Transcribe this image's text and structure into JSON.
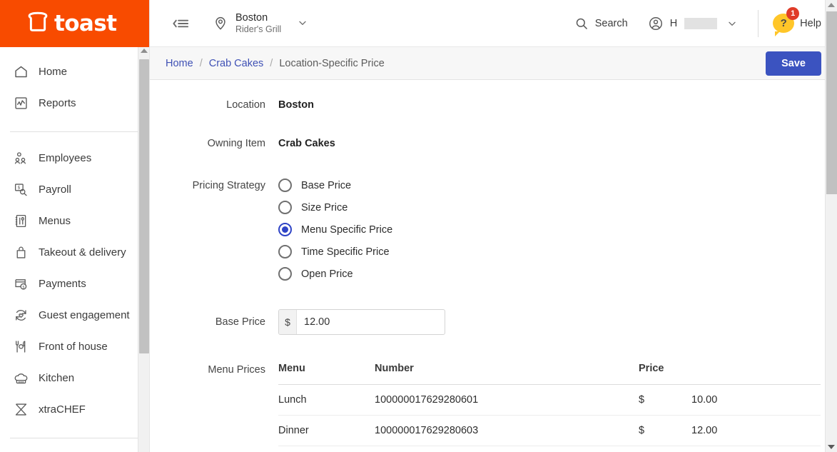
{
  "brand": {
    "name": "toast",
    "logo_icon": "toast-bread-icon",
    "color": "#f84b00"
  },
  "sidebar": {
    "groups": [
      {
        "items": [
          {
            "label": "Home",
            "icon": "home-icon"
          },
          {
            "label": "Reports",
            "icon": "reports-chart-icon"
          }
        ]
      },
      {
        "items": [
          {
            "label": "Employees",
            "icon": "employees-icon"
          },
          {
            "label": "Payroll",
            "icon": "payroll-icon"
          },
          {
            "label": "Menus",
            "icon": "menus-icon"
          },
          {
            "label": "Takeout & delivery",
            "icon": "takeout-bag-icon"
          },
          {
            "label": "Payments",
            "icon": "payments-icon"
          },
          {
            "label": "Guest engagement",
            "icon": "guest-engagement-icon"
          },
          {
            "label": "Front of house",
            "icon": "front-of-house-icon"
          },
          {
            "label": "Kitchen",
            "icon": "kitchen-chef-hat-icon"
          },
          {
            "label": "xtraCHEF",
            "icon": "xtrachef-icon"
          }
        ]
      }
    ]
  },
  "topbar": {
    "collapse_icon": "collapse-sidebar-icon",
    "location": {
      "pin_icon": "location-pin-icon",
      "name": "Boston",
      "restaurant": "Rider's Grill",
      "caret_icon": "chevron-down-icon"
    },
    "search": {
      "label": "Search",
      "icon": "search-icon"
    },
    "account": {
      "icon": "user-avatar-icon",
      "name": "H",
      "caret_icon": "chevron-down-icon"
    },
    "help": {
      "label": "Help",
      "icon": "help-question-bubble-icon",
      "badge": "1",
      "badge_color": "#e03b28",
      "bubble_color": "#ffc629"
    }
  },
  "breadcrumb": {
    "items": [
      "Home",
      "Crab Cakes",
      "Location-Specific Price"
    ],
    "separator": "/"
  },
  "actions": {
    "save_label": "Save",
    "save_color": "#3b53c0"
  },
  "form": {
    "location": {
      "label": "Location",
      "value": "Boston"
    },
    "owning_item": {
      "label": "Owning Item",
      "value": "Crab Cakes"
    },
    "pricing_strategy": {
      "label": "Pricing Strategy",
      "selected": "Menu Specific Price",
      "options": [
        {
          "label": "Base Price",
          "selected": false
        },
        {
          "label": "Size Price",
          "selected": false
        },
        {
          "label": "Menu Specific Price",
          "selected": true
        },
        {
          "label": "Time Specific Price",
          "selected": false
        },
        {
          "label": "Open Price",
          "selected": false
        }
      ]
    },
    "base_price": {
      "label": "Base Price",
      "currency": "$",
      "value": "12.00",
      "placeholder": ""
    },
    "menu_prices": {
      "label": "Menu Prices",
      "columns": [
        "Menu",
        "Number",
        "Price"
      ],
      "rows": [
        {
          "menu": "Lunch",
          "number": "100000017629280601",
          "currency": "$",
          "price": "10.00"
        },
        {
          "menu": "Dinner",
          "number": "100000017629280603",
          "currency": "$",
          "price": "12.00"
        }
      ]
    }
  }
}
